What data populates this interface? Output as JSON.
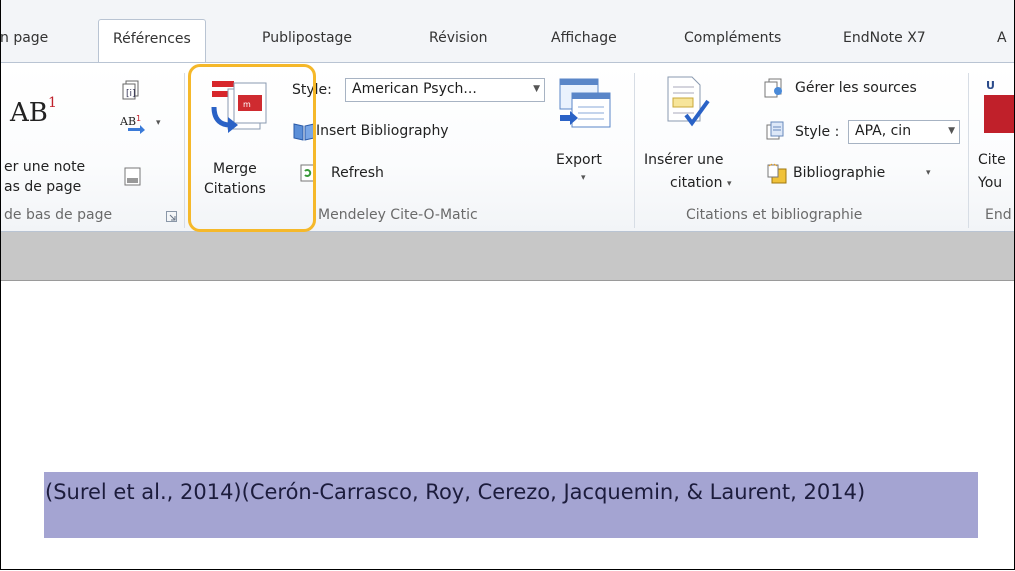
{
  "tabs": [
    {
      "label": "n page"
    },
    {
      "label": "Références",
      "active": true
    },
    {
      "label": "Publipostage"
    },
    {
      "label": "Révision"
    },
    {
      "label": "Affichage"
    },
    {
      "label": "Compléments"
    },
    {
      "label": "EndNote X7"
    },
    {
      "label": "A"
    }
  ],
  "footnotes_group": {
    "insert_line1": "er une note",
    "insert_line2": "as de page",
    "group_label": "de bas de page"
  },
  "mendeley_group": {
    "merge_line1": "Merge",
    "merge_line2": "Citations",
    "style_label": "Style:",
    "style_value": "American Psych...",
    "insert_bibliography": "Insert Bibliography",
    "refresh": "Refresh",
    "export": "Export",
    "group_label": "Mendeley Cite-O-Matic"
  },
  "citations_group": {
    "insert_line1": "Insérer une",
    "insert_line2": "citation",
    "manage_sources": "Gérer les sources",
    "style_label": "Style :",
    "style_value": "APA, cin",
    "bibliography": "Bibliographie",
    "group_label": "Citations et bibliographie"
  },
  "endnote_group": {
    "line1": "Cite",
    "line2": "You",
    "group_label": "End"
  },
  "document": {
    "selected_text": "(Surel et al., 2014)(Cerón-Carrasco, Roy, Cerezo, Jacquemin, & Laurent, 2014)"
  },
  "colors": {
    "highlight_ring": "#f5b82a",
    "selection": "#a4a4d2",
    "endnote_red": "#c0202a"
  }
}
